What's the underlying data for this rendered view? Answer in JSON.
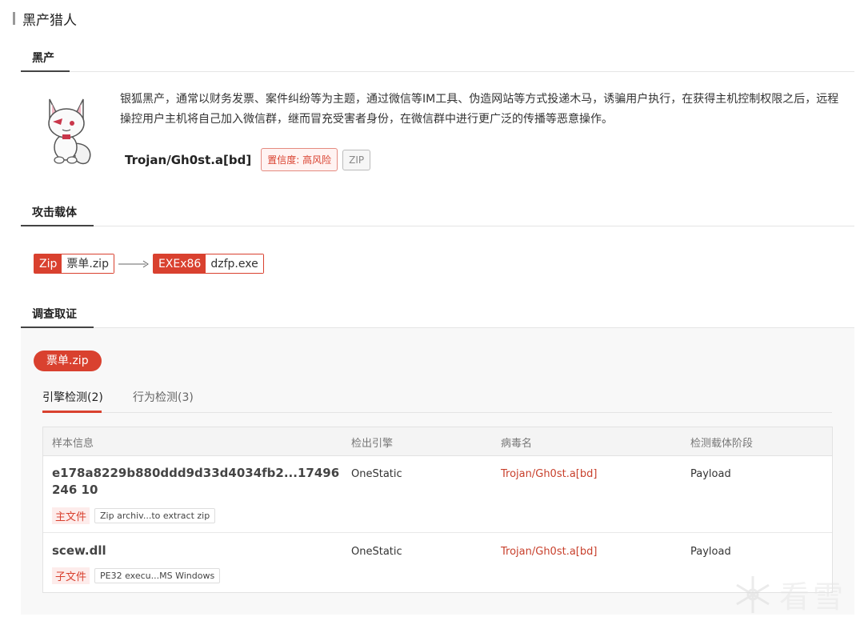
{
  "page": {
    "title": "黑产猎人"
  },
  "sections": {
    "black_industry": "黑产",
    "attack_payload": "攻击载体",
    "investigation": "调查取证"
  },
  "gang": {
    "description": "银狐黑产，通常以财务发票、案件纠纷等为主题，通过微信等IM工具、伪造网站等方式投递木马，诱骗用户执行，在获得主机控制权限之后，远程操控用户主机将自己加入微信群，继而冒充受害者身份，在微信群中进行更广泛的传播等恶意操作。",
    "family": "Trojan/Gh0st.a[bd]",
    "risk_tag": "置信度: 高风险",
    "type_tag": "ZIP",
    "mascot_icon": "silver-fox-mascot"
  },
  "payload_chain": [
    {
      "type": "Zip",
      "name": "票单.zip"
    },
    {
      "type": "EXEx86",
      "name": "dzfp.exe"
    }
  ],
  "investigation": {
    "file_pill": "票单.zip",
    "tabs": [
      {
        "label": "引擎检测(2)",
        "active": true
      },
      {
        "label": "行为检测(3)",
        "active": false
      }
    ],
    "table": {
      "headers": [
        "样本信息",
        "检出引擎",
        "病毒名",
        "检测载体阶段"
      ],
      "rows": [
        {
          "sample": "e178a8229b880ddd9d33d4034fb2...17496246 10",
          "role": "主文件",
          "file_type": "Zip archiv...to extract   zip",
          "engine": "OneStatic",
          "virus": "Trojan/Gh0st.a[bd]",
          "stage": "Payload"
        },
        {
          "sample": "scew.dll",
          "role": "子文件",
          "file_type": "PE32 execu...MS Windows",
          "engine": "OneStatic",
          "virus": "Trojan/Gh0st.a[bd]",
          "stage": "Payload"
        }
      ]
    }
  },
  "watermark": {
    "text": "看雪",
    "icon": "snowflake-icon"
  },
  "colors": {
    "accent": "#d9412f",
    "virus_text": "#c8402c"
  }
}
